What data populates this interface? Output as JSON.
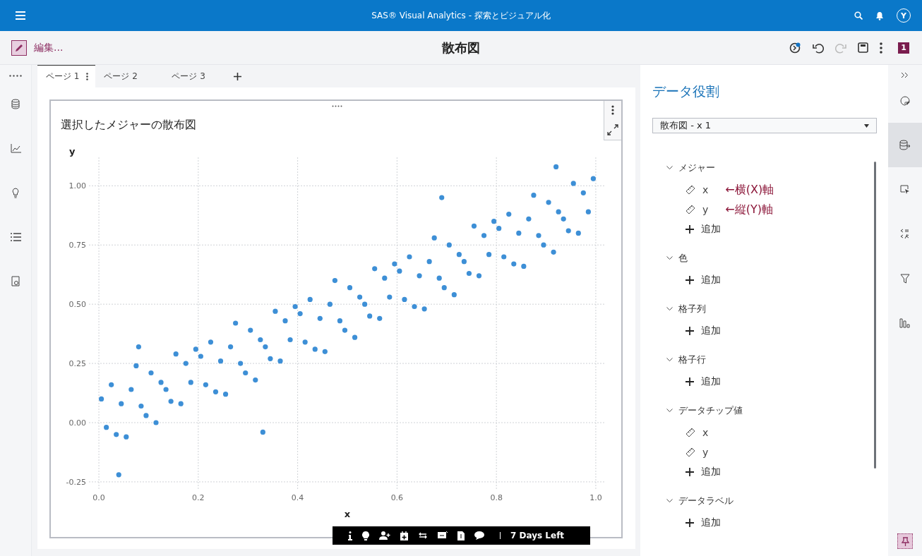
{
  "app_bar": {
    "title": "SAS® Visual Analytics - 探索とビジュアル化",
    "avatar": "Y"
  },
  "header": {
    "edit_label": "編集...",
    "title": "散布図",
    "badge": "1"
  },
  "left_rail": [
    {
      "kind": "data"
    },
    {
      "kind": "objects"
    },
    {
      "kind": "suggestions"
    },
    {
      "kind": "outline"
    },
    {
      "kind": "report"
    }
  ],
  "tabs": [
    {
      "label": "ページ 1",
      "selected": true
    },
    {
      "label": "ページ 2",
      "selected": false
    },
    {
      "label": "ページ 3",
      "selected": false
    }
  ],
  "chart": {
    "title": "選択したメジャーの散布図",
    "chart_data": {
      "type": "scatter",
      "xlabel": "x",
      "ylabel": "y",
      "x": [
        0.005,
        0.015,
        0.025,
        0.035,
        0.045,
        0.055,
        0.065,
        0.075,
        0.085,
        0.095,
        0.105,
        0.115,
        0.125,
        0.135,
        0.145,
        0.155,
        0.165,
        0.175,
        0.185,
        0.195,
        0.205,
        0.215,
        0.225,
        0.235,
        0.245,
        0.255,
        0.265,
        0.275,
        0.285,
        0.295,
        0.305,
        0.315,
        0.325,
        0.335,
        0.345,
        0.355,
        0.365,
        0.375,
        0.385,
        0.395,
        0.405,
        0.415,
        0.425,
        0.435,
        0.445,
        0.455,
        0.465,
        0.475,
        0.485,
        0.495,
        0.505,
        0.515,
        0.525,
        0.535,
        0.545,
        0.555,
        0.565,
        0.575,
        0.585,
        0.595,
        0.605,
        0.615,
        0.625,
        0.635,
        0.645,
        0.655,
        0.665,
        0.675,
        0.685,
        0.695,
        0.705,
        0.715,
        0.725,
        0.735,
        0.745,
        0.755,
        0.765,
        0.775,
        0.785,
        0.795,
        0.805,
        0.815,
        0.825,
        0.835,
        0.845,
        0.855,
        0.865,
        0.875,
        0.885,
        0.895,
        0.905,
        0.915,
        0.925,
        0.935,
        0.945,
        0.955,
        0.965,
        0.975,
        0.985,
        0.995,
        0.04,
        0.33,
        0.92,
        0.08,
        0.69
      ],
      "series": [
        {
          "color": "#3d8fd6",
          "values": [
            0.1,
            -0.02,
            0.16,
            -0.05,
            0.08,
            -0.06,
            0.14,
            0.24,
            0.07,
            0.03,
            0.21,
            0.0,
            0.17,
            0.14,
            0.09,
            0.29,
            0.08,
            0.25,
            0.17,
            0.31,
            0.28,
            0.16,
            0.34,
            0.13,
            0.26,
            0.12,
            0.32,
            0.42,
            0.25,
            0.21,
            0.39,
            0.18,
            0.35,
            0.32,
            0.27,
            0.47,
            0.26,
            0.43,
            0.35,
            0.49,
            0.46,
            0.34,
            0.52,
            0.31,
            0.44,
            0.3,
            0.5,
            0.6,
            0.43,
            0.39,
            0.57,
            0.36,
            0.53,
            0.5,
            0.45,
            0.65,
            0.44,
            0.61,
            0.53,
            0.67,
            0.64,
            0.52,
            0.7,
            0.49,
            0.62,
            0.48,
            0.68,
            0.78,
            0.61,
            0.57,
            0.75,
            0.54,
            0.71,
            0.68,
            0.63,
            0.83,
            0.62,
            0.79,
            0.71,
            0.85,
            0.82,
            0.7,
            0.88,
            0.67,
            0.8,
            0.66,
            0.86,
            0.96,
            0.79,
            0.75,
            0.93,
            0.72,
            0.89,
            0.86,
            0.81,
            1.01,
            0.8,
            0.97,
            0.89,
            1.03,
            -0.22,
            -0.04,
            1.08,
            0.32,
            0.95
          ]
        }
      ],
      "grid": true,
      "xlim": [
        -0.02,
        1.02
      ],
      "ylim": [
        -0.28,
        1.12
      ],
      "xticks": [
        {
          "value": 0,
          "label": "0.0"
        },
        {
          "value": 0.2,
          "label": "0.2"
        },
        {
          "value": 0.4,
          "label": "0.4"
        },
        {
          "value": 0.6,
          "label": "0.6"
        },
        {
          "value": 0.8,
          "label": "0.8"
        },
        {
          "value": 1,
          "label": "1.0"
        }
      ],
      "yticks": [
        {
          "value": -0.25,
          "label": "-0.25"
        },
        {
          "value": 0,
          "label": "0.00"
        },
        {
          "value": 0.25,
          "label": "0.25"
        },
        {
          "value": 0.5,
          "label": "0.50"
        },
        {
          "value": 0.75,
          "label": "0.75"
        },
        {
          "value": 1,
          "label": "1.00"
        }
      ]
    }
  },
  "trial_bar": {
    "label": "7 Days Left"
  },
  "roles_panel": {
    "title": "データ役割",
    "dropdown": "散布図 - x 1",
    "sections": [
      {
        "label": "メジャー",
        "expanded": true,
        "items": [
          {
            "kind": "measure",
            "label": "x",
            "note": "←横(X)軸"
          },
          {
            "kind": "measure",
            "label": "y",
            "note": "←縦(Y)軸"
          },
          {
            "kind": "add",
            "label": "追加"
          }
        ]
      },
      {
        "label": "色",
        "expanded": true,
        "items": [
          {
            "kind": "add",
            "label": "追加"
          }
        ]
      },
      {
        "label": "格子列",
        "expanded": true,
        "items": [
          {
            "kind": "add",
            "label": "追加"
          }
        ]
      },
      {
        "label": "格子行",
        "expanded": true,
        "items": [
          {
            "kind": "add",
            "label": "追加"
          }
        ]
      },
      {
        "label": "データチップ値",
        "expanded": true,
        "items": [
          {
            "kind": "measure",
            "label": "x"
          },
          {
            "kind": "measure",
            "label": "y"
          },
          {
            "kind": "add",
            "label": "追加"
          }
        ]
      },
      {
        "label": "データラベル",
        "expanded": true,
        "items": [
          {
            "kind": "add",
            "label": "追加"
          }
        ]
      }
    ]
  },
  "right_rail": [
    {
      "kind": "options",
      "selected": false
    },
    {
      "kind": "roles",
      "selected": true
    },
    {
      "kind": "actions",
      "selected": false
    },
    {
      "kind": "rules",
      "selected": false
    },
    {
      "kind": "filters",
      "selected": false
    },
    {
      "kind": "ranks",
      "selected": false
    }
  ],
  "pin": {
    "selected": true
  }
}
